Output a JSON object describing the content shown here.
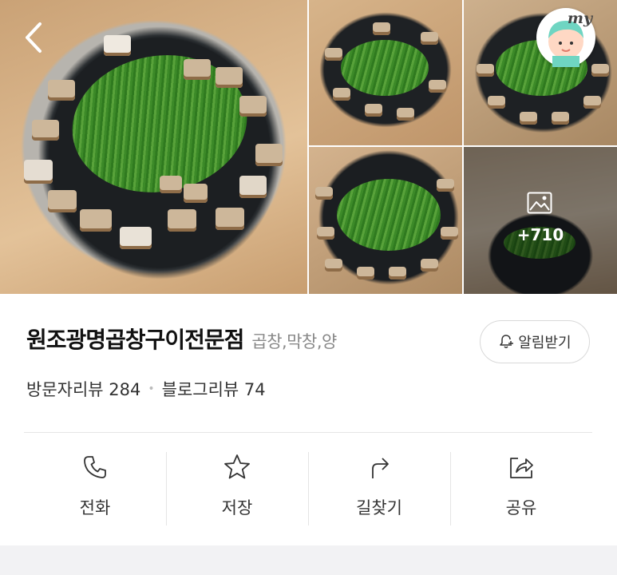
{
  "gallery": {
    "more_count": "+710",
    "photos": [
      "main-photo",
      "photo-2",
      "photo-3",
      "photo-4",
      "photo-5-more"
    ]
  },
  "header": {
    "back_icon": "chevron-left-icon",
    "my_badge_text": "my"
  },
  "place": {
    "name": "원조광명곱창구이전문점",
    "category": "곱창,막창,양",
    "notify_label": "알림받기"
  },
  "reviews": {
    "visitor_label": "방문자리뷰 284",
    "separator": "•",
    "blog_label": "블로그리뷰 74"
  },
  "actions": [
    {
      "icon": "phone-icon",
      "label": "전화"
    },
    {
      "icon": "star-icon",
      "label": "저장"
    },
    {
      "icon": "directions-icon",
      "label": "길찾기"
    },
    {
      "icon": "share-icon",
      "label": "공유"
    }
  ],
  "colors": {
    "text_primary": "#111111",
    "text_secondary": "#888888",
    "divider": "#e5e5e5",
    "band": "#f2f2f4"
  }
}
